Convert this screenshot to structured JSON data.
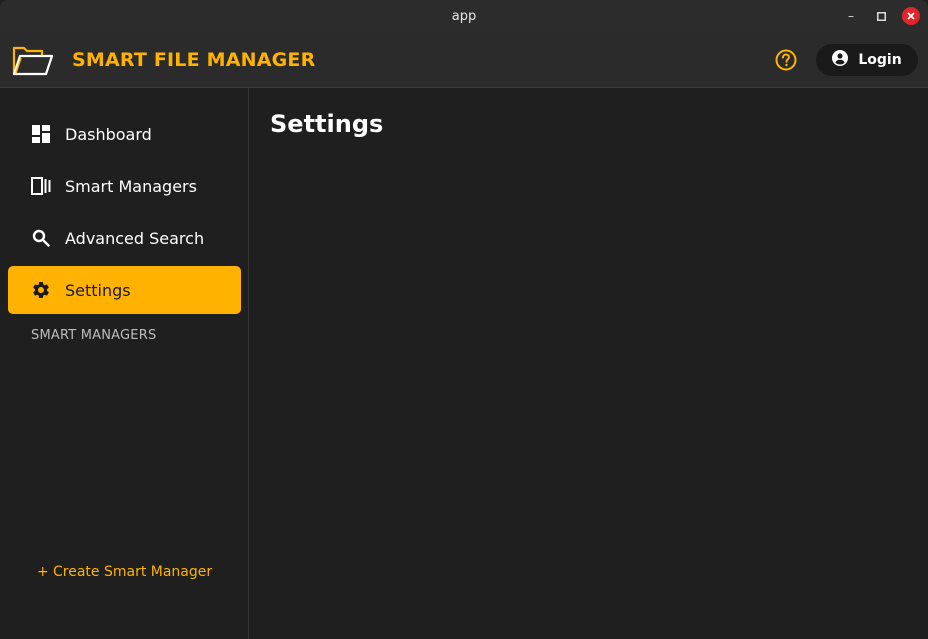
{
  "window": {
    "title": "app",
    "controls": {
      "minimize": "–",
      "maximize": "□",
      "close": "✕"
    }
  },
  "header": {
    "app_title": "SMART FILE MANAGER",
    "help_icon": "help-circle-icon",
    "login_label": "Login",
    "accent": "#ffb300"
  },
  "sidebar": {
    "items": [
      {
        "label": "Dashboard",
        "icon": "dashboard-icon",
        "active": false
      },
      {
        "label": "Smart Managers",
        "icon": "smart-managers-icon",
        "active": false
      },
      {
        "label": "Advanced Search",
        "icon": "search-icon",
        "active": false
      },
      {
        "label": "Settings",
        "icon": "gear-icon",
        "active": true
      }
    ],
    "section_label": "SMART MANAGERS",
    "create_label": "+ Create Smart Manager"
  },
  "main": {
    "title": "Settings"
  }
}
